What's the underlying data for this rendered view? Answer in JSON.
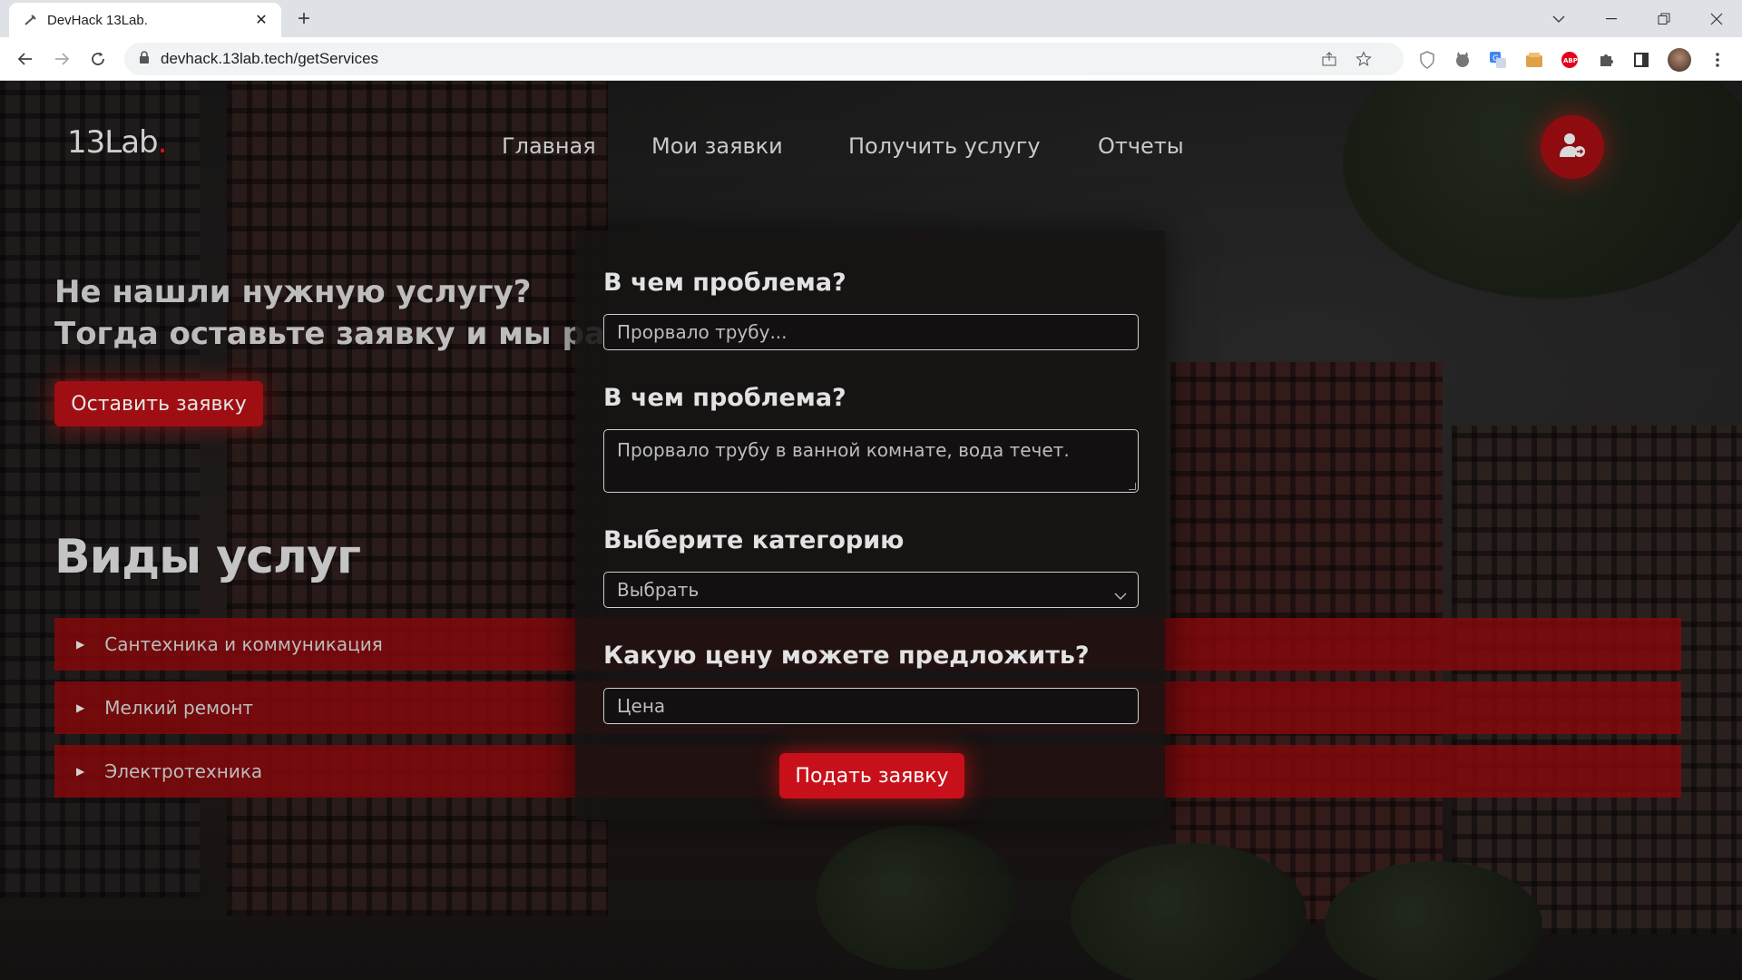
{
  "browser": {
    "tab_title": "DevHack 13Lab.",
    "url": "devhack.13lab.tech/getServices"
  },
  "site": {
    "logo_text": "13Lab",
    "logo_dot": ".",
    "nav": [
      "Главная",
      "Мои заявки",
      "Получить услугу",
      "Отчеты"
    ]
  },
  "hero": {
    "line1": "Не нашли нужную услугу?",
    "line2": "Тогда оставьте заявку и мы расс",
    "button": "Оставить заявку"
  },
  "services": {
    "title": "Виды услуг",
    "items": [
      "Сантехника и коммуникация",
      "Мелкий ремонт",
      "Электротехника"
    ]
  },
  "form": {
    "label_title": "В чем проблема?",
    "title_placeholder": "Прорвало трубу...",
    "label_description": "В чем проблема?",
    "description_placeholder": "Прорвало трубу в ванной комнате, вода течет.",
    "label_category": "Выберите категорию",
    "category_selected": "Выбрать",
    "label_price": "Какую цену можете предложить?",
    "price_placeholder": "Цена",
    "submit": "Подать заявку"
  },
  "colors": {
    "accent": "#c8101a",
    "service_bar": "#82080c",
    "logo_dot": "#d9141b"
  }
}
